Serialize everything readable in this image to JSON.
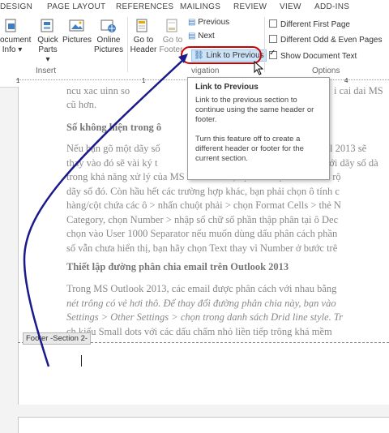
{
  "tabs": [
    "DESIGN",
    "PAGE LAYOUT",
    "REFERENCES",
    "MAILINGS",
    "REVIEW",
    "VIEW",
    "ADD-INS"
  ],
  "ribbon": {
    "insert_group": {
      "label": "Insert",
      "document_info": [
        "ocument",
        "Info ▾"
      ],
      "quick_parts": [
        "Quick",
        "Parts ▾"
      ],
      "pictures": "Pictures",
      "online_pictures": [
        "Online",
        "Pictures"
      ]
    },
    "navigation_group": {
      "label": "vigation",
      "goto_header": [
        "Go to",
        "Header"
      ],
      "goto_footer": [
        "Go to",
        "Footer"
      ],
      "previous": "Previous",
      "next": "Next",
      "link_to_previous": "Link to Previous"
    },
    "options_group": {
      "label": "Options",
      "different_first_page": "Different First Page",
      "different_odd_even": "Different Odd & Even Pages",
      "show_document_text": "Show Document Text"
    }
  },
  "ruler": {
    "num1": "1",
    "num4": "4"
  },
  "document": {
    "line_top_a": "ncu xac uinn so",
    "line_top_b": "i cai dai MS",
    "line_top_c": "cũ hơn.",
    "heading1": "Số không hiện trong ô",
    "para1_l1a": "Nếu bạn gõ một dãy số",
    "para1_l1b": "Excel 2013 sẽ",
    "para1_l2a": "thay vào đó sẽ vài ký t",
    "para1_l2b": "với dãy số dà",
    "para1_rest": [
      "trong khả năng xử lý của MS Excel 2013, bạn chỉ việc kéo ô tính rộ",
      "dãy số đó. Còn hầu hết các trường hợp khác, bạn phải chọn ô tính c",
      "hàng/cột chứa các ô > nhấn chuột phải > chọn Format Cells > thẻ N",
      "Category, chọn Number > nhập số chữ số phần thập phân tại ô Dec",
      "chọn vào User 1000 Separator nếu muốn dùng dấu phân cách phần",
      "số vẫn chưa hiển thị, bạn hãy chọn Text thay vì Number ở bước trê"
    ],
    "heading2": "Thiết lập đường phân chia email trên Outlook 2013",
    "para2_lines": [
      "Trong MS Outlook 2013, các email được phân cách với nhau bằng",
      "nét trông có vẻ hơi thô. Để thay đổi đường phân chia này, bạn vào",
      "Settings > Other Settings > chọn trong danh sách Drid line style. Tr",
      "ch kiểu Small dots với các dấu chấm nhỏ liền tiếp trông khá mềm"
    ],
    "footer_tag": "Footer -Section 2-"
  },
  "tooltip": {
    "title": "Link to Previous",
    "body1": "Link to the previous section to continue using the same header or footer.",
    "body2": "Turn this feature off to create a different header or footer for the current section."
  },
  "colors": {
    "highlight": "#cc0000",
    "arrow": "#1a1a8c",
    "link_icon": "#2b6cb0"
  }
}
